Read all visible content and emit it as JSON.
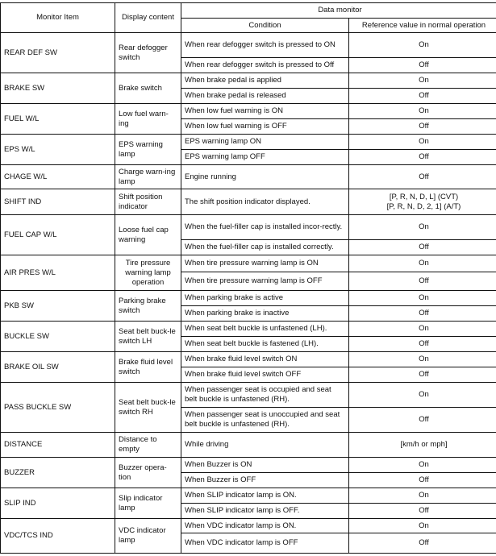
{
  "header": {
    "monitor_item": "Monitor Item",
    "display_content": "Display content",
    "data_monitor": "Data monitor",
    "condition": "Condition",
    "reference": "Reference value in normal operation"
  },
  "rows": [
    {
      "item": "REAR DEF SW",
      "display": "Rear defogger switch",
      "conds": [
        {
          "cond": "When rear defogger switch is pressed to ON",
          "ref": "On"
        },
        {
          "cond": "When rear defogger switch is pressed to Off",
          "ref": "Off"
        }
      ]
    },
    {
      "item": "BRAKE SW",
      "display": "Brake switch",
      "conds": [
        {
          "cond": "When brake pedal is applied",
          "ref": "On"
        },
        {
          "cond": "When brake pedal is released",
          "ref": "Off"
        }
      ]
    },
    {
      "item": "FUEL W/L",
      "display": "Low fuel warn-ing",
      "conds": [
        {
          "cond": "When low fuel warning is ON",
          "ref": "On"
        },
        {
          "cond": "When low fuel warning is OFF",
          "ref": "Off"
        }
      ]
    },
    {
      "item": "EPS W/L",
      "display": "EPS warning lamp",
      "conds": [
        {
          "cond": "EPS warning lamp ON",
          "ref": "On"
        },
        {
          "cond": "EPS warning lamp OFF",
          "ref": "Off"
        }
      ]
    },
    {
      "item": "CHAGE W/L",
      "display": "Charge warn-ing lamp",
      "conds": [
        {
          "cond": "Engine running",
          "ref": "Off"
        }
      ]
    },
    {
      "item": "SHIFT IND",
      "display": "Shift position indicator",
      "conds": [
        {
          "cond": "The shift position indicator displayed.",
          "ref": "[P, R, N, D, L] (CVT)\n[P, R, N, D, 2, 1] (A/T)"
        }
      ]
    },
    {
      "item": "FUEL CAP W/L",
      "display": "Loose fuel cap warning",
      "conds": [
        {
          "cond": "When the fuel-filler cap is installed incor-rectly.",
          "ref": "On"
        },
        {
          "cond": "When the fuel-filler cap is installed correctly.",
          "ref": "Off"
        }
      ]
    },
    {
      "item": "AIR PRES W/L",
      "display": "Tire pressure warning lamp operation",
      "conds": [
        {
          "cond": "When tire pressure warning lamp is ON",
          "ref": "On"
        },
        {
          "cond": "When tire pressure warning lamp is OFF",
          "ref": "Off"
        }
      ]
    },
    {
      "item": "PKB SW",
      "display": "Parking brake switch",
      "conds": [
        {
          "cond": "When parking brake is active",
          "ref": "On"
        },
        {
          "cond": "When parking brake is inactive",
          "ref": "Off"
        }
      ]
    },
    {
      "item": "BUCKLE SW",
      "display": "Seat belt buck-le switch LH",
      "conds": [
        {
          "cond": "When seat belt buckle is unfastened (LH).",
          "ref": "On"
        },
        {
          "cond": "When seat belt buckle is fastened (LH).",
          "ref": "Off"
        }
      ]
    },
    {
      "item": "BRAKE OIL SW",
      "display": "Brake fluid level switch",
      "conds": [
        {
          "cond": "When brake fluid level switch ON",
          "ref": "On"
        },
        {
          "cond": "When brake fluid level switch OFF",
          "ref": "Off"
        }
      ]
    },
    {
      "item": "PASS BUCKLE SW",
      "display": "Seat belt buck-le switch RH",
      "conds": [
        {
          "cond": "When passenger seat is occupied and seat belt buckle is unfastened (RH).",
          "ref": "On"
        },
        {
          "cond": "When passenger seat is unoccupied and seat belt buckle is unfastened (RH).",
          "ref": "Off"
        }
      ]
    },
    {
      "item": "DISTANCE",
      "display": "Distance to empty",
      "conds": [
        {
          "cond": "While driving",
          "ref": "[km/h or mph]"
        }
      ]
    },
    {
      "item": "BUZZER",
      "display": "Buzzer opera-tion",
      "conds": [
        {
          "cond": "When Buzzer is ON",
          "ref": "On"
        },
        {
          "cond": "When Buzzer is OFF",
          "ref": "Off"
        }
      ]
    },
    {
      "item": "SLIP IND",
      "display": "Slip indicator lamp",
      "conds": [
        {
          "cond": "When SLIP indicator lamp is ON.",
          "ref": "On"
        },
        {
          "cond": "When SLIP indicator lamp is OFF.",
          "ref": "Off"
        }
      ]
    },
    {
      "item": "VDC/TCS IND",
      "display": "VDC indicator lamp",
      "conds": [
        {
          "cond": "When VDC indicator lamp is ON.",
          "ref": "On"
        },
        {
          "cond": "When VDC indicator lamp is OFF",
          "ref": "Off"
        }
      ]
    }
  ]
}
